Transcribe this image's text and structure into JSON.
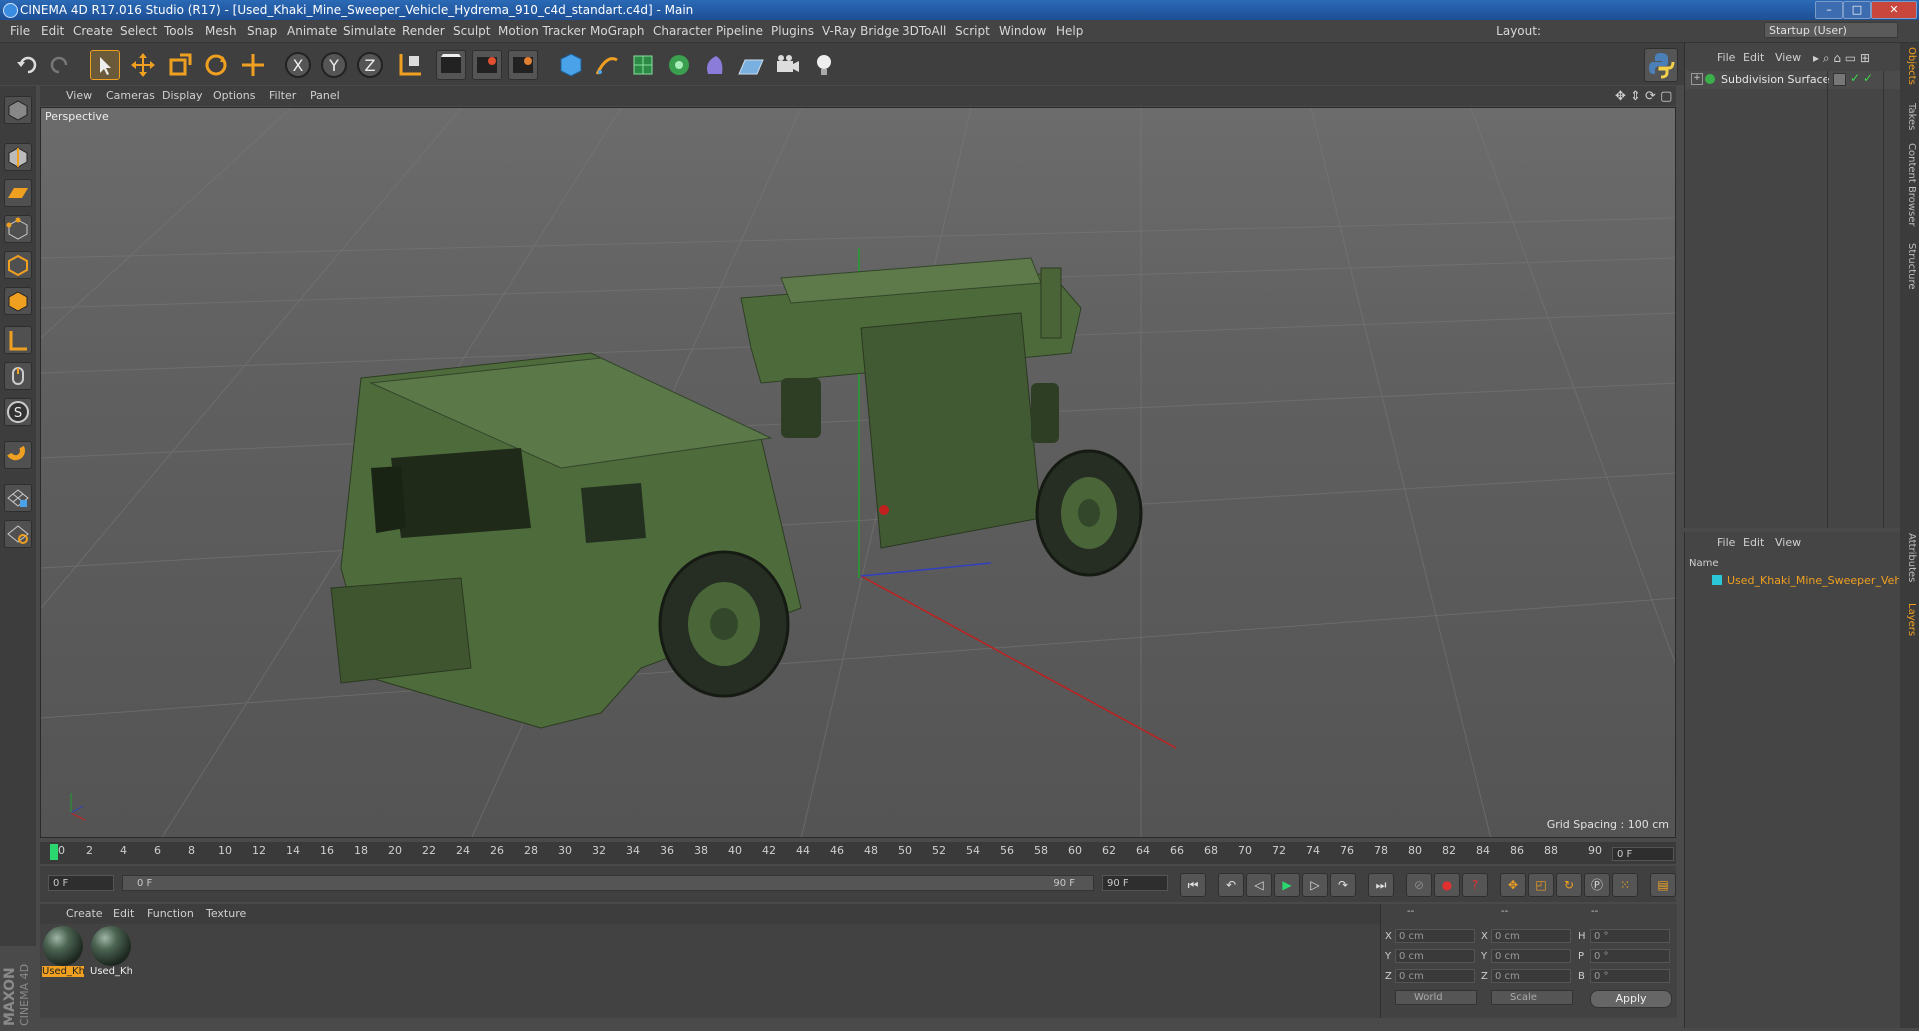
{
  "window": {
    "title": "CINEMA 4D R17.016 Studio (R17) - [Used_Khaki_Mine_Sweeper_Vehicle_Hydrema_910_c4d_standart.c4d] - Main",
    "controls": [
      "–",
      "□",
      "✕"
    ]
  },
  "menubar": {
    "items": [
      "File",
      "Edit",
      "Create",
      "Select",
      "Tools",
      "Mesh",
      "Snap",
      "Animate",
      "Simulate",
      "Render",
      "Sculpt",
      "Motion Tracker",
      "MoGraph",
      "Character",
      "Pipeline",
      "Plugins",
      "V-Ray Bridge",
      "3DToAll",
      "Script",
      "Window",
      "Help"
    ],
    "layout_label": "Layout:",
    "layout_value": "Startup (User)"
  },
  "toolbar": {
    "icons": [
      "undo-icon",
      "redo-icon",
      "select-arrow-icon",
      "move-icon",
      "scale-icon",
      "rotate-icon",
      "live-select-icon",
      "axis-x-icon",
      "axis-y-icon",
      "axis-z-icon",
      "coordinate-system-icon",
      "render-view-icon",
      "render-picture-viewer-icon",
      "render-settings-icon",
      "cube-icon",
      "pen-spline-icon",
      "subdivision-icon",
      "mograph-cloner-icon",
      "deformer-icon",
      "floor-icon",
      "camera-icon",
      "light-icon"
    ],
    "axis_labels": [
      "X",
      "Y",
      "Z"
    ],
    "python_icon": "python-icon"
  },
  "left_tools": [
    "model-mode-icon",
    "texture-mode-icon",
    "workplane-icon",
    "point-mode-icon",
    "edge-mode-icon",
    "polygon-mode-icon",
    "uv-mode-icon",
    "tweak-mode-icon",
    "solo-icon",
    "magnet-icon",
    "snap-grid-icon",
    "snap-settings-icon"
  ],
  "viewport": {
    "menu": [
      "View",
      "Cameras",
      "Display",
      "Options",
      "Filter",
      "Panel"
    ],
    "camera_label": "Perspective",
    "grid_spacing": "Grid Spacing : 100 cm"
  },
  "timeline": {
    "ticks": [
      "0",
      "2",
      "4",
      "6",
      "8",
      "10",
      "12",
      "14",
      "16",
      "18",
      "20",
      "22",
      "24",
      "26",
      "28",
      "30",
      "32",
      "34",
      "36",
      "38",
      "40",
      "42",
      "44",
      "46",
      "48",
      "50",
      "52",
      "54",
      "56",
      "58",
      "60",
      "62",
      "64",
      "66",
      "68",
      "70",
      "72",
      "74",
      "76",
      "78",
      "80",
      "82",
      "84",
      "86",
      "88",
      "90"
    ],
    "current_frame": "0 F"
  },
  "transport": {
    "start_field": "0 F",
    "range_start": "0 F",
    "range_end": "90 F",
    "end_field": "90 F"
  },
  "materials": {
    "menu": [
      "Create",
      "Edit",
      "Function",
      "Texture"
    ],
    "items": [
      {
        "label": "Used_Kh",
        "selected": true
      },
      {
        "label": "Used_Kh",
        "selected": false
      }
    ]
  },
  "coordinates": {
    "header": [
      "--",
      "--",
      "--"
    ],
    "rows": [
      {
        "axis1": "X",
        "val1": "0 cm",
        "axis2": "X",
        "val2": "0 cm",
        "axis3": "H",
        "val3": "0 °"
      },
      {
        "axis1": "Y",
        "val1": "0 cm",
        "axis2": "Y",
        "val2": "0 cm",
        "axis3": "P",
        "val3": "0 °"
      },
      {
        "axis1": "Z",
        "val1": "0 cm",
        "axis2": "Z",
        "val2": "0 cm",
        "axis3": "B",
        "val3": "0 °"
      }
    ],
    "world_select": "World",
    "scale_select": "Scale",
    "apply": "Apply"
  },
  "object_manager": {
    "menu": [
      "File",
      "Edit",
      "View"
    ],
    "objects": [
      "Subdivision Surface"
    ]
  },
  "layer_manager": {
    "menu": [
      "File",
      "Edit",
      "View"
    ],
    "column": "Name",
    "layers": [
      "Used_Khaki_Mine_Sweeper_Vehic"
    ]
  },
  "side_tabs": [
    "Objects",
    "Takes",
    "Content Browser",
    "Structure",
    "Attributes",
    "Layers"
  ],
  "brand": {
    "maxon": "MAXON",
    "c4d": "CINEMA 4D"
  },
  "colors": {
    "accent": "#f0a020",
    "vehicle": "#4f6a3c",
    "title_bar": "#2b6ab6",
    "layer_color": "#2bc7d8"
  }
}
